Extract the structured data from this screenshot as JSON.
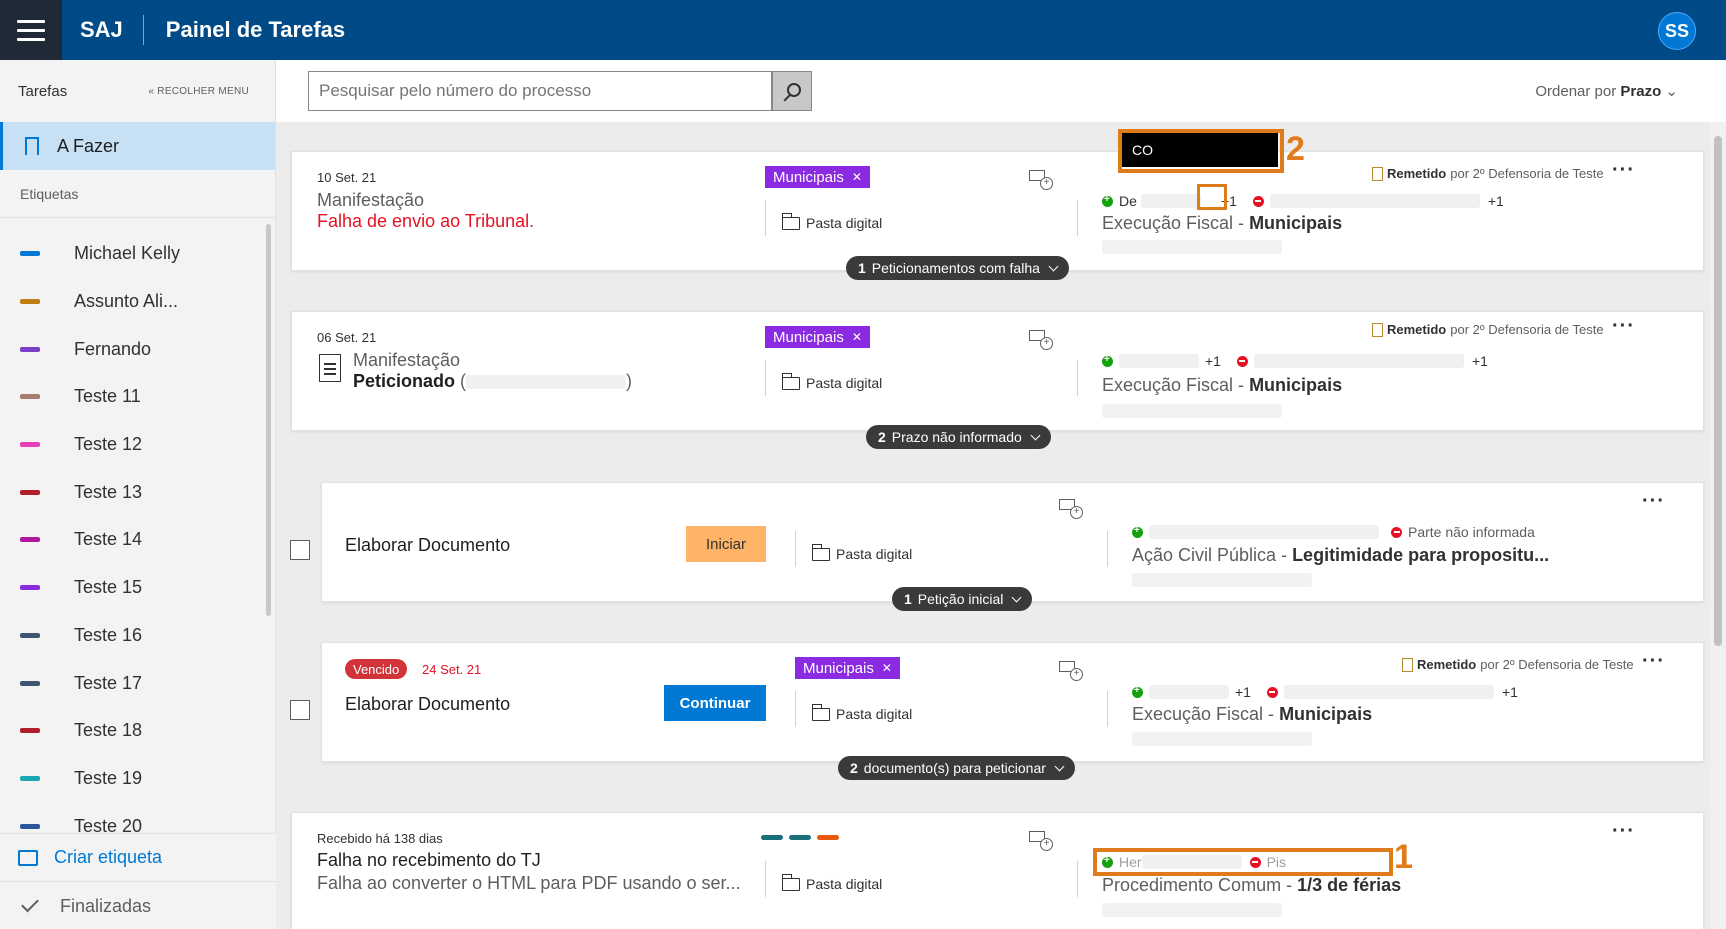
{
  "header": {
    "brand": "SAJ",
    "title": "Painel de Tarefas",
    "avatar_initials": "SS"
  },
  "sidebar": {
    "title": "Tarefas",
    "collapse_label": "« RECOLHER MENU",
    "active_item": "A Fazer",
    "section_label": "Etiquetas",
    "tags": [
      {
        "label": "Michael Kelly",
        "color": "#0078d4"
      },
      {
        "label": "Assunto Ali...",
        "color": "#c17d11"
      },
      {
        "label": "Fernando",
        "color": "#7a3fc9"
      },
      {
        "label": "Teste 11",
        "color": "#a67c6d"
      },
      {
        "label": "Teste 12",
        "color": "#e83fb8"
      },
      {
        "label": "Teste 13",
        "color": "#b21e2c"
      },
      {
        "label": "Teste 14",
        "color": "#b0179e"
      },
      {
        "label": "Teste 15",
        "color": "#8a2be2"
      },
      {
        "label": "Teste 16",
        "color": "#3d5670"
      },
      {
        "label": "Teste 17",
        "color": "#3d5670"
      },
      {
        "label": "Teste 18",
        "color": "#b21e2c"
      },
      {
        "label": "Teste 19",
        "color": "#1aa7b3"
      },
      {
        "label": "Teste 20",
        "color": "#2b579a"
      }
    ],
    "create_label": "Criar etiqueta",
    "done_label": "Finalizadas"
  },
  "toolbar": {
    "search_placeholder": "Pesquisar pelo número do processo",
    "sort_prefix": "Ordenar por",
    "sort_value": "Prazo"
  },
  "cards": [
    {
      "date": "10 Set. 21",
      "title": "Manifestação",
      "subtitle": "Falha de envio ao Tribunal.",
      "tag": "Municipais",
      "pasta": "Pasta digital",
      "remetido": "Remetido",
      "remetido_by": "por 2º Defensoria de Teste",
      "party_left": "De",
      "plus_left": "+1",
      "plus_right": "+1",
      "case_class": "Execução Fiscal - ",
      "case_subject": "Municipais",
      "pill_count": "1",
      "pill_label": "Peticionamentos com falha"
    },
    {
      "date": "06 Set. 21",
      "title": "Manifestação",
      "subtitle_bold": "Peticionado",
      "subtitle_paren_open": "(",
      "subtitle_paren_close": ")",
      "tag": "Municipais",
      "pasta": "Pasta digital",
      "remetido": "Remetido",
      "remetido_by": "por 2º Defensoria de Teste",
      "plus_left": "+1",
      "plus_right": "+1",
      "case_class": "Execução Fiscal - ",
      "case_subject": "Municipais",
      "pill_count": "2",
      "pill_label": "Prazo não informado"
    },
    {
      "title": "Elaborar Documento",
      "button": "Iniciar",
      "pasta": "Pasta digital",
      "party_right": "Parte não informada",
      "case_class": "Ação Civil Pública - ",
      "case_subject": "Legitimidade para propositu...",
      "pill_count": "1",
      "pill_label": "Petição inicial"
    },
    {
      "badge": "Vencido",
      "date": "24 Set. 21",
      "title": "Elaborar Documento",
      "button": "Continuar",
      "tag": "Municipais",
      "pasta": "Pasta digital",
      "remetido": "Remetido",
      "remetido_by": "por 2º Defensoria de Teste",
      "plus_left": "+1",
      "plus_right": "+1",
      "case_class": "Execução Fiscal - ",
      "case_subject": "Municipais",
      "pill_count": "2",
      "pill_label": "documento(s) para peticionar"
    },
    {
      "date": "Recebido há 138 dias",
      "title": "Falha no recebimento do TJ",
      "subtitle": "Falha ao converter o HTML para PDF usando o ser...",
      "pasta": "Pasta digital",
      "party_left": "Her",
      "party_right": "Pis",
      "case_class": "Procedimento Comum - ",
      "case_subject": "1/3 de férias",
      "mini_colors": [
        "#1b6f7a",
        "#1b6f7a",
        "#e8590c"
      ]
    }
  ],
  "annotations": {
    "one": "1",
    "two": "2",
    "tip_text": "CO"
  }
}
